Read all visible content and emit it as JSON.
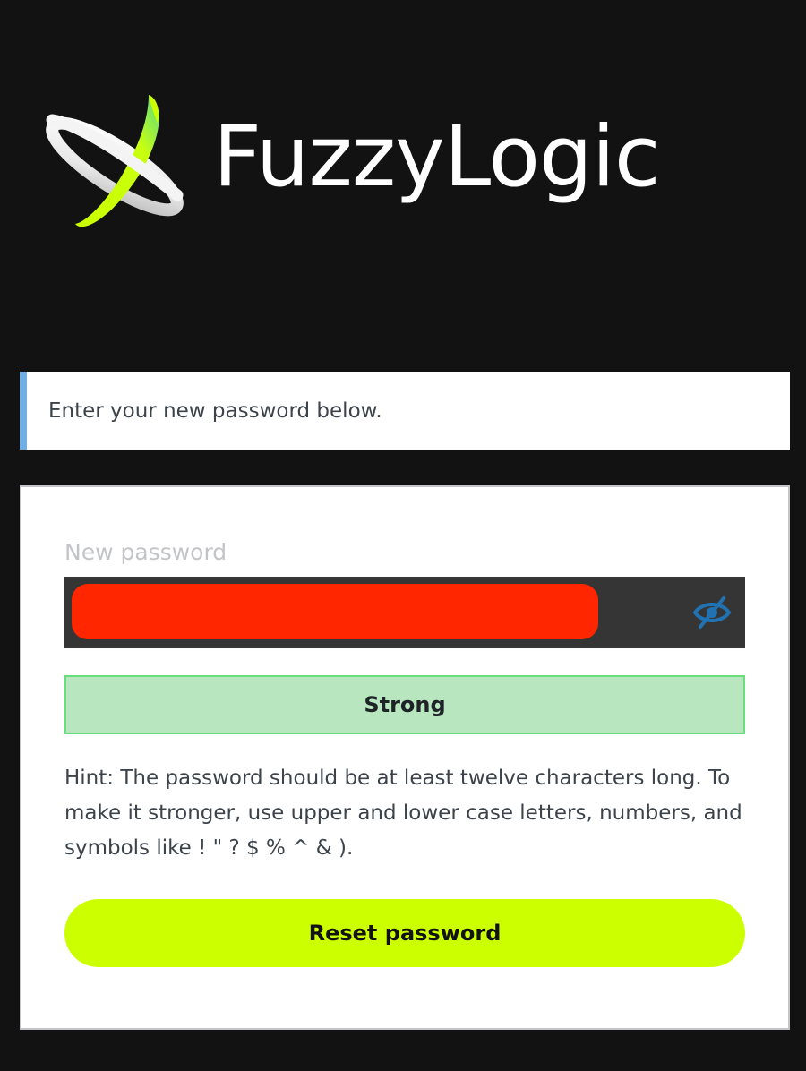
{
  "brand": {
    "name": "FuzzyLogic",
    "accent_color": "#ccff00",
    "logo_icon": "orbit-logo-icon"
  },
  "message": {
    "text": "Enter your new password below.",
    "border_color": "#72aee6"
  },
  "form": {
    "password_label": "New password",
    "password_value": "",
    "toggle_icon": "eye-slash-icon",
    "strength_label": "Strong",
    "hint": "Hint: The password should be at least twelve characters long. To make it stronger, use upper and lower case letters, numbers, and symbols like ! \" ? $ % ^ & ).",
    "submit_label": "Reset password"
  }
}
